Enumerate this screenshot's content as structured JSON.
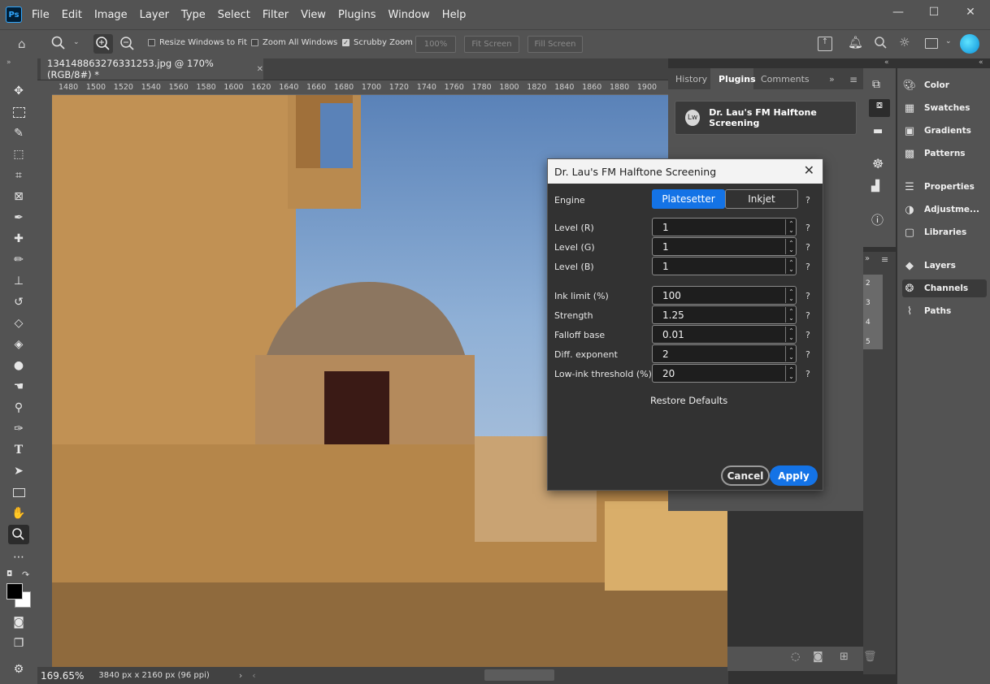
{
  "menubar": {
    "logo": "Ps",
    "items": [
      "File",
      "Edit",
      "Image",
      "Layer",
      "Type",
      "Select",
      "Filter",
      "View",
      "Plugins",
      "Window",
      "Help"
    ],
    "minimize": "—",
    "maximize": "☐",
    "close": "✕"
  },
  "options": {
    "resize_windows": "Resize Windows to Fit",
    "zoom_all": "Zoom All Windows",
    "scrubby_zoom": "Scrubby Zoom",
    "zoom_value": "100%",
    "fit_screen": "Fit Screen",
    "fill_screen": "Fill Screen",
    "resize_checked": false,
    "zoom_all_checked": false,
    "scrubby_checked": true
  },
  "document": {
    "tab_title": "134148863276331253.jpg @ 170% (RGB/8#) *",
    "ruler_marks": [
      "1480",
      "1500",
      "1520",
      "1540",
      "1560",
      "1580",
      "1600",
      "1620",
      "1640",
      "1660",
      "1680",
      "1700",
      "1720",
      "1740",
      "1760",
      "1780",
      "1800",
      "1820",
      "1840",
      "1860",
      "1880",
      "1900"
    ],
    "zoom": "169.65%",
    "dimensions": "3840 px x 2160 px (96 ppi)"
  },
  "panel_group": {
    "tabs": [
      "History",
      "Plugins",
      "Comments"
    ],
    "active_tab": "Plugins",
    "plugin_entry": "Dr. Lau's FM Halftone Screening"
  },
  "layers_strip": [
    "2",
    "3",
    "4",
    "5"
  ],
  "right_dock": {
    "items": [
      {
        "label": "Color",
        "icon": "color-icon"
      },
      {
        "label": "Swatches",
        "icon": "swatches-icon"
      },
      {
        "label": "Gradients",
        "icon": "gradients-icon"
      },
      {
        "label": "Patterns",
        "icon": "patterns-icon"
      },
      {
        "label": "Properties",
        "icon": "properties-icon"
      },
      {
        "label": "Adjustme...",
        "icon": "adjustments-icon"
      },
      {
        "label": "Libraries",
        "icon": "libraries-icon"
      },
      {
        "label": "Layers",
        "icon": "layers-icon"
      },
      {
        "label": "Channels",
        "icon": "channels-icon"
      },
      {
        "label": "Paths",
        "icon": "paths-icon"
      }
    ],
    "active": "Channels"
  },
  "dialog": {
    "title": "Dr. Lau's FM Halftone Screening",
    "engine_label": "Engine",
    "engine_options": [
      "Platesetter",
      "Inkjet"
    ],
    "engine_selected": "Platesetter",
    "help": "?",
    "fields": [
      {
        "label": "Level (R)",
        "value": "1"
      },
      {
        "label": "Level (G)",
        "value": "1"
      },
      {
        "label": "Level (B)",
        "value": "1"
      },
      {
        "label": "Ink limit (%)",
        "value": "100"
      },
      {
        "label": "Strength",
        "value": "1.25"
      },
      {
        "label": "Falloff base",
        "value": "0.01"
      },
      {
        "label": "Diff. exponent",
        "value": "2"
      },
      {
        "label": "Low-ink threshold (%)",
        "value": "20"
      }
    ],
    "restore": "Restore Defaults",
    "cancel": "Cancel",
    "apply": "Apply",
    "accent": "#1473e6"
  }
}
